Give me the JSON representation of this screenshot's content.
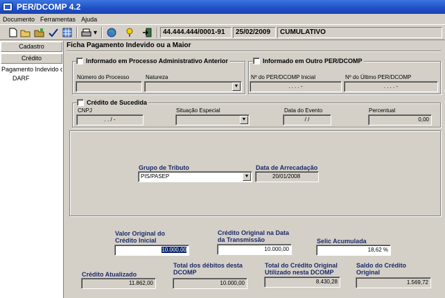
{
  "window": {
    "title": "PER/DCOMP 4.2"
  },
  "menu": [
    "Documento",
    "Ferramentas",
    "Ajuda"
  ],
  "toolbar": {
    "icons": [
      "new-icon",
      "open-icon",
      "folder-icon",
      "check-icon",
      "grid-icon",
      "print-icon",
      "globe-icon",
      "help-icon",
      "exit-icon"
    ],
    "cnpj": "44.444.444/0001-91",
    "date": "25/02/2009",
    "status": "CUMULATIVO"
  },
  "sidebar": {
    "cadastro": "Cadastro",
    "credito": "Crédito",
    "items": [
      "Pagamento Indevido ou",
      "DARF"
    ]
  },
  "ficha": {
    "title": "Ficha Pagamento Indevido ou a Maior"
  },
  "proc_adm": {
    "label": "Informado em Processo Administrativo Anterior",
    "numero_label": "Número do Processo",
    "natureza_label": "Natureza"
  },
  "outro_perdcomp": {
    "label": "Informado em Outro PER/DCOMP",
    "inicial_label": "Nº do PER/DCOMP Inicial",
    "inicial_value": ". . . . -",
    "ultimo_label": "Nº do Último PER/DCOMP",
    "ultimo_value": ". . . . -"
  },
  "sucedida": {
    "label": "Crédito de Sucedida",
    "cnpj_label": "CNPJ",
    "cnpj_value": ". . / -",
    "situacao_label": "Situação Especial",
    "data_label": "Data do Evento",
    "data_value": "/ /",
    "percentual_label": "Percentual",
    "percentual_value": "0,00"
  },
  "tributo": {
    "grupo_label": "Grupo de Tributo",
    "grupo_value": "PIS/PASEP",
    "data_label": "Data de Arrecadação",
    "data_value": "20/01/2008"
  },
  "valores": {
    "original_label": "Valor Original do Crédito Inicial",
    "original_value": "10.000,00",
    "transmissao_label": "Crédito Original na Data da Transmissão",
    "transmissao_value": "10.000,00",
    "selic_label": "Selic Acumulada",
    "selic_value": "18,62 %",
    "atualizado_label": "Crédito Atualizado",
    "atualizado_value": "11.862,00",
    "debitos_label": "Total dos débitos desta DCOMP",
    "debitos_value": "10.000,00",
    "utilizado_label": "Total do Crédito Original Utilizado nesta DCOMP",
    "utilizado_value": "8.430,28",
    "saldo_label": "Saldo do Crédito Original",
    "saldo_value": "1.569,72"
  }
}
